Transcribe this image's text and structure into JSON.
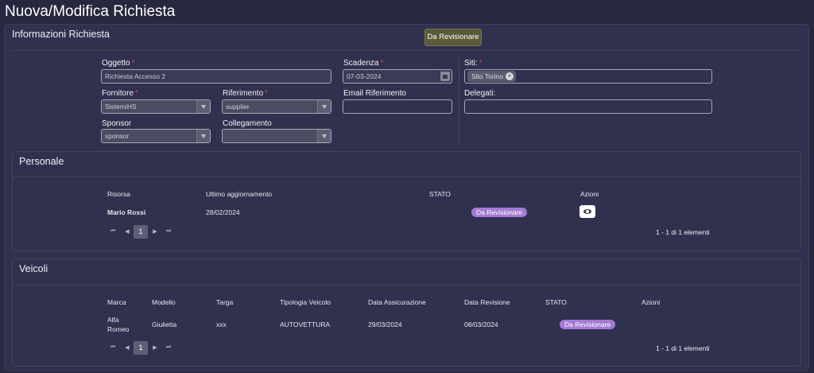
{
  "page": {
    "title": "Nuova/Modifica Richiesta"
  },
  "info": {
    "title": "Informazioni Richiesta",
    "status_button": "Da Revisionare",
    "oggetto": {
      "label": "Oggetto",
      "value": "Richiesta Accesso 2"
    },
    "scadenza": {
      "label": "Scadenza",
      "value": "07-03-2024"
    },
    "siti": {
      "label": "Siti:",
      "chip": "Sito Torino"
    },
    "fornitore": {
      "label": "Fornitore",
      "value": "SistemiHS"
    },
    "riferimento": {
      "label": "Riferimento",
      "value": "supplier"
    },
    "email": {
      "label": "Email Riferimento",
      "value": ""
    },
    "delegati": {
      "label": "Delegati:",
      "value": ""
    },
    "sponsor": {
      "label": "Sponsor",
      "value": "sponsor"
    },
    "collegamento": {
      "label": "Collegamento",
      "value": ""
    },
    "required_mark": "*"
  },
  "personale": {
    "title": "Personale",
    "headers": {
      "risorsa": "Risorsa",
      "ultimo": "Ultimo aggiornamento",
      "stato": "STATO",
      "azioni": "Azioni"
    },
    "rows": [
      {
        "risorsa": "Mario Rossi",
        "ultimo": "28/02/2024",
        "stato": "Da Revisionare"
      }
    ],
    "pagination": {
      "first": "⏮",
      "prev": "◀",
      "page": "1",
      "next": "▶",
      "last": "⏭",
      "info": "1 - 1 di 1 elementi"
    }
  },
  "veicoli": {
    "title": "Veicoli",
    "headers": {
      "marca": "Marca",
      "modello": "Modello",
      "targa": "Targa",
      "tipologia": "Tipologia Veicolo",
      "assicurazione": "Data Assicurazione",
      "revisione": "Data Revisione",
      "stato": "STATO",
      "azioni": "Azioni"
    },
    "rows": [
      {
        "marca_1": "Alfa",
        "marca_2": "Romeo",
        "modello": "Giulietta",
        "targa": "xxx",
        "tipologia": "AUTOVETTURA",
        "assicurazione": "29/03/2024",
        "revisione": "08/03/2024",
        "stato": "Da Revisionare"
      }
    ],
    "pagination": {
      "first": "⏮",
      "prev": "◀",
      "page": "1",
      "next": "▶",
      "last": "⏭",
      "info": "1 - 1 di 1 elementi"
    }
  },
  "colors": {
    "background": "#27273f",
    "panel": "#30304f",
    "badge": "#a37ad4",
    "status_button": "#5a5a3a",
    "required": "#e04848"
  }
}
